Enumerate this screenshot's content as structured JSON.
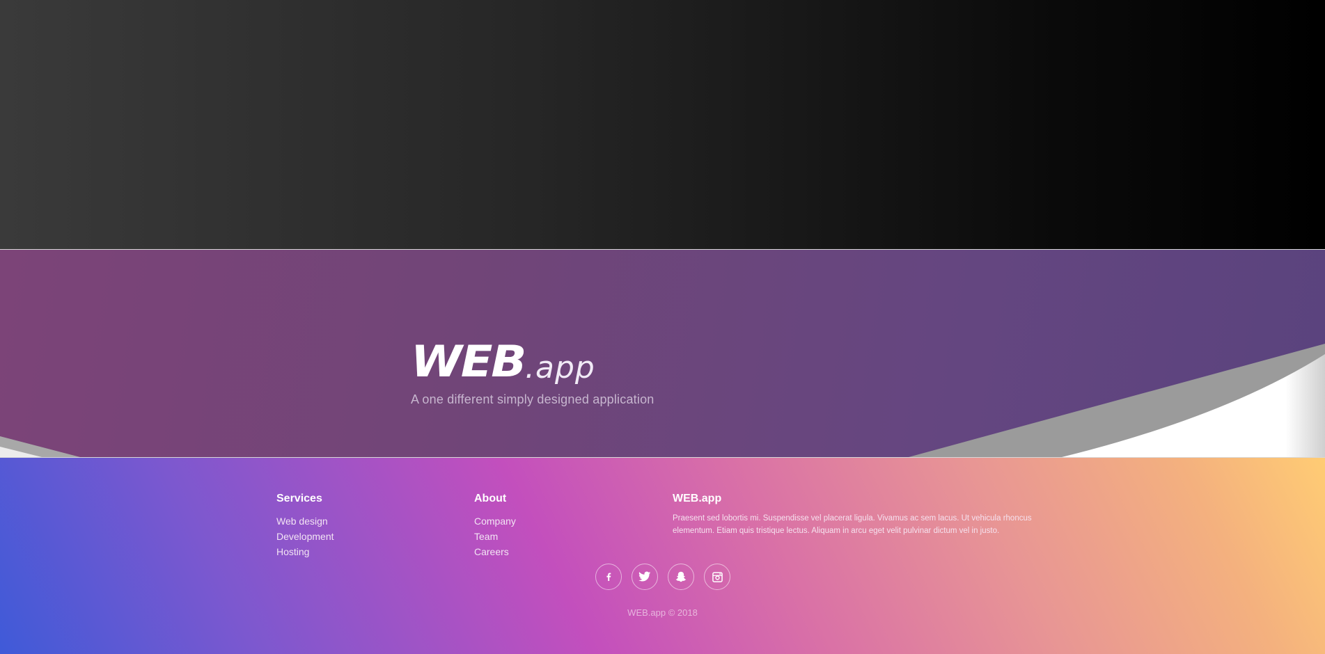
{
  "hero": {
    "logo_main": "WEB",
    "logo_suffix": ".app",
    "tagline": "A one different simply designed application"
  },
  "footer": {
    "services": {
      "title": "Services",
      "items": [
        "Web design",
        "Development",
        "Hosting"
      ]
    },
    "about": {
      "title": "About",
      "items": [
        "Company",
        "Team",
        "Careers"
      ]
    },
    "webapp": {
      "title": "WEB.app",
      "description": "Praesent sed lobortis mi. Suspendisse vel placerat ligula. Vivamus ac sem lacus. Ut vehicula rhoncus elementum. Etiam quis tristique lectus. Aliquam in arcu eget velit pulvinar dictum vel in justo."
    },
    "socials": [
      {
        "name": "facebook-icon",
        "glyph": "f"
      },
      {
        "name": "twitter-icon",
        "glyph": "bird"
      },
      {
        "name": "snapchat-icon",
        "glyph": "ghost"
      },
      {
        "name": "instagram-icon",
        "glyph": "camera"
      }
    ],
    "copyright": "WEB.app © 2018"
  },
  "colors": {
    "top_dark": "#000000",
    "mid_purple": "#714578",
    "footer_blue": "#3f5ad8",
    "footer_magenta": "#c34fbd",
    "footer_orange": "#ffcc74"
  }
}
